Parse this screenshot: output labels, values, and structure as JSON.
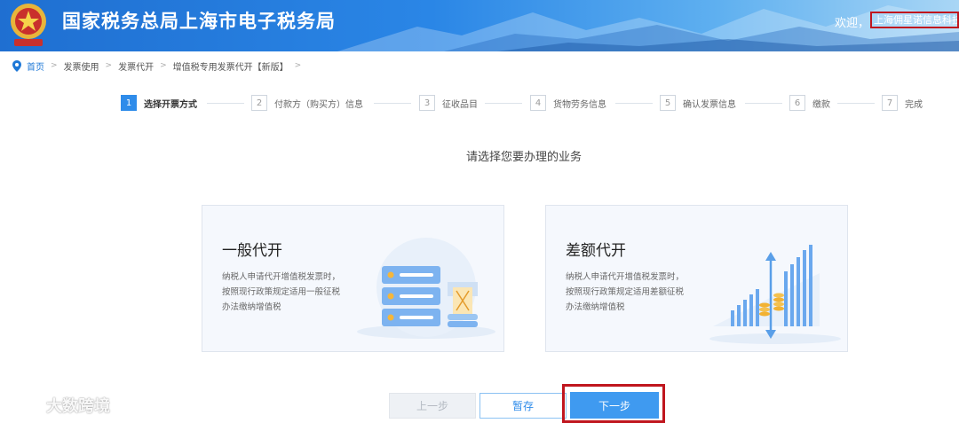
{
  "header": {
    "title": "国家税务总局上海市电子税务局",
    "welcome": "欢迎，",
    "username": "上海佣星诺信息科技"
  },
  "breadcrumb": [
    "首页",
    "发票使用",
    "发票代开",
    "增值税专用发票代开【新版】"
  ],
  "steps": [
    {
      "num": "1",
      "label": "选择开票方式",
      "active": true
    },
    {
      "num": "2",
      "label": "付款方（购买方）信息",
      "active": false
    },
    {
      "num": "3",
      "label": "征收品目",
      "active": false
    },
    {
      "num": "4",
      "label": "货物劳务信息",
      "active": false
    },
    {
      "num": "5",
      "label": "确认发票信息",
      "active": false
    },
    {
      "num": "6",
      "label": "缴款",
      "active": false
    },
    {
      "num": "7",
      "label": "完成",
      "active": false
    }
  ],
  "prompt": "请选择您要办理的业务",
  "cards": [
    {
      "title": "一般代开",
      "desc": [
        "纳税人申请代开增值税发票时，",
        "按照现行政策规定适用一般征税",
        "办法缴纳增值税"
      ],
      "icon": "server-stack-icon"
    },
    {
      "title": "差额代开",
      "desc": [
        "纳税人申请代开增值税发票时，",
        "按照现行政策规定适用差额征税",
        "办法缴纳增值税"
      ],
      "icon": "bar-chart-coins-icon"
    }
  ],
  "buttons": {
    "prev": "上一步",
    "save": "暂存",
    "next": "下一步"
  },
  "watermark": "大数跨境",
  "colors": {
    "brand": "#2f8cea",
    "highlight": "#c0161e"
  }
}
